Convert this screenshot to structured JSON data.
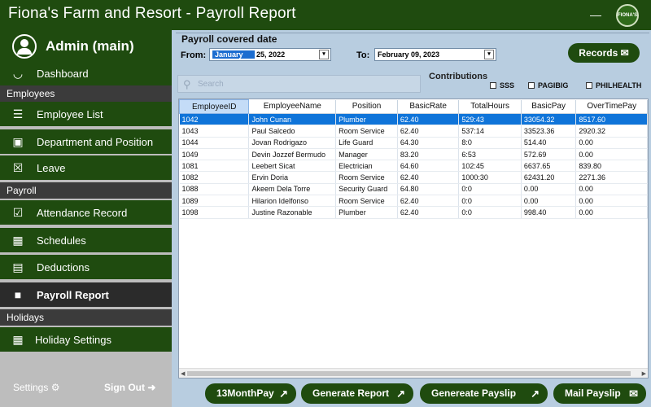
{
  "window": {
    "title": "Fiona's Farm and Resort - Payroll Report",
    "minimize_icon": "minimize-icon",
    "logo_text": "FIONA'S"
  },
  "sidebar": {
    "user": "Admin (main)",
    "dashboard": "Dashboard",
    "employees_section": "Employees",
    "employee_list": "Employee List",
    "department": "Department and Position",
    "leave": "Leave",
    "payroll_section": "Payroll",
    "attendance": "Attendance Record",
    "schedules": "Schedules",
    "deductions": "Deductions",
    "payroll_report": "Payroll Report",
    "holidays_section": "Holidays",
    "holiday_settings": "Holiday Settings",
    "settings": "Settings",
    "sign_out": "Sign Out"
  },
  "date_panel": {
    "heading": "Payroll covered date",
    "from_label": "From:",
    "from_month": "January",
    "from_rest": "25, 2022",
    "to_label": "To:",
    "to_value": "February  09, 2023"
  },
  "records_button": "Records",
  "search": {
    "placeholder": "Search"
  },
  "contributions": {
    "label": "Contributions",
    "sss": "SSS",
    "pagibig": "PAGIBIG",
    "philhealth": "PHILHEALTH"
  },
  "table": {
    "columns": [
      "EmployeeID",
      "EmployeeName",
      "Position",
      "BasicRate",
      "TotalHours",
      "BasicPay",
      "OverTimePay"
    ],
    "rows": [
      [
        "1042",
        "John Cunan",
        "Plumber",
        "62.40",
        "529:43",
        "33054.32",
        "8517.60"
      ],
      [
        "1043",
        "Paul Salcedo",
        "Room Service",
        "62.40",
        "537:14",
        "33523.36",
        "2920.32"
      ],
      [
        "1044",
        "Jovan Rodrigazo",
        "Life Guard",
        "64.30",
        "8:0",
        "514.40",
        "0.00"
      ],
      [
        "1049",
        "Devin Jozzef Bermudo",
        "Manager",
        "83.20",
        "6:53",
        "572.69",
        "0.00"
      ],
      [
        "1081",
        "Leebert Sicat",
        "Electrician",
        "64.60",
        "102:45",
        "6637.65",
        "839.80"
      ],
      [
        "1082",
        "Ervin Doria",
        "Room Service",
        "62.40",
        "1000:30",
        "62431.20",
        "2271.36"
      ],
      [
        "1088",
        "Akeem Dela Torre",
        "Security Guard",
        "64.80",
        "0:0",
        "0.00",
        "0.00"
      ],
      [
        "1089",
        "Hilarion Idelfonso",
        "Room Service",
        "62.40",
        "0:0",
        "0.00",
        "0.00"
      ],
      [
        "1098",
        "Justine Razonable",
        "Plumber",
        "62.40",
        "0:0",
        "998.40",
        "0.00"
      ]
    ]
  },
  "buttons": {
    "month13": "13MonthPay",
    "generate_report": "Generate Report",
    "generate_payslip": "Genereate Payslip",
    "mail_payslip": "Mail Payslip"
  },
  "colors": {
    "primary_green": "#1f4b0f",
    "selected_row": "#0f74d9",
    "background": "#b8cde0"
  }
}
